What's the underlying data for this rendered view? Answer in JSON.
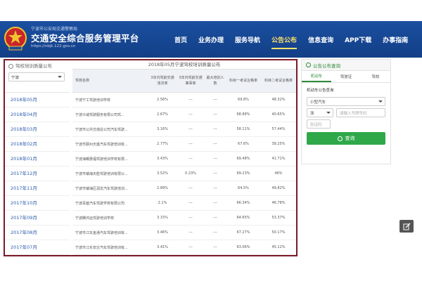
{
  "header": {
    "site_sub": "宁波市公安局交通警察局",
    "site_title": "交通安全综合服务管理平台",
    "site_url": "https://nbjk.122.gov.cn",
    "nav": [
      {
        "label": "首页"
      },
      {
        "label": "业务办理"
      },
      {
        "label": "服务导航"
      },
      {
        "label": "公告公布",
        "active": true
      },
      {
        "label": "信息查询"
      },
      {
        "label": "APP下载"
      },
      {
        "label": "办事指南"
      }
    ]
  },
  "left": {
    "title": "驾校培训质量公布",
    "select_value": "宁波",
    "months": [
      "2018年05月",
      "2018年04月",
      "2018年03月",
      "2018年02月",
      "2018年01月",
      "2017年12月",
      "2017年11月",
      "2017年10月",
      "2017年09月",
      "2017年08月",
      "2017年07月"
    ]
  },
  "table": {
    "title": "2018年05月宁波驾校培训质量公布",
    "headers": [
      "驾校名称",
      "3年内驾龄交通违法率",
      "3年内驾龄交通肇事率",
      "最大培训人数",
      "科目一考试合格率",
      "科目二考试合格率"
    ],
    "rows": [
      [
        "宁波宁工驾驶培训学校",
        "2.56%",
        "---",
        "---",
        "69.8%",
        "48.32%"
      ],
      [
        "宁波众诚驾驶服务有限公司驾...",
        "2.67%",
        "---",
        "---",
        "68.88%",
        "40.65%"
      ],
      [
        "宁波市公共交通总公司汽车驾驶...",
        "3.16%",
        "---",
        "---",
        "58.11%",
        "57.44%"
      ],
      [
        "宁波市鄞州天盛汽车驾驶培训有...",
        "2.77%",
        "---",
        "---",
        "67.6%",
        "39.25%"
      ],
      [
        "宁波海曙惠福驾驶培训学校有限...",
        "3.43%",
        "---",
        "---",
        "69.48%",
        "41.71%"
      ],
      [
        "宁波市镇海天胜驾驶培训有限公...",
        "3.52%",
        "0.23%",
        "---",
        "69.23%",
        "46%"
      ],
      [
        "宁波市镇海区润龙汽车驾驶培训...",
        "2.89%",
        "---",
        "---",
        "64.5%",
        "49.82%"
      ],
      [
        "宁波百盛汽车驾驶学校有限公司",
        "2.1%",
        "---",
        "---",
        "66.34%",
        "46.78%"
      ],
      [
        "宁波腾鸿远驾驶培训学校",
        "3.15%",
        "---",
        "---",
        "64.65%",
        "53.37%"
      ],
      [
        "宁波市江东金通汽车驾驶培训有...",
        "3.46%",
        "---",
        "---",
        "67.27%",
        "50.17%"
      ],
      [
        "宁波市江东安达汽车驾驶培训有...",
        "3.41%",
        "---",
        "---",
        "63.06%",
        "45.12%"
      ]
    ]
  },
  "side": {
    "title": "公告公布查询",
    "tabs": [
      "机动车",
      "驾驶证",
      "驾校"
    ],
    "label": "机动车公告查询",
    "vehicle_type": "小型汽车",
    "plate_prefix": "浙",
    "plate_placeholder": "请输入号牌号码",
    "code_placeholder": "验证码",
    "query_label": "查询"
  },
  "colors": {
    "header_blue": "#1a4fa0",
    "active_nav": "#ffe16a",
    "accent_green": "#2fa84a",
    "frame": "#7a1a26"
  }
}
